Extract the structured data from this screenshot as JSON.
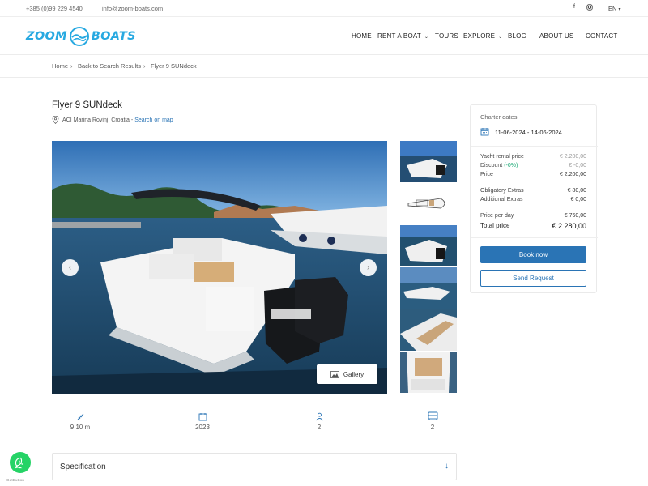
{
  "topbar": {
    "phone": "+385 (0)99 229 4540",
    "email": "info@zoom-boats.com",
    "language": "EN"
  },
  "brand": {
    "word_left": "ZOOM",
    "word_right": "BOATS",
    "color": "#27a9e1"
  },
  "nav": {
    "items": [
      {
        "label": "HOME"
      },
      {
        "label": "RENT A BOAT",
        "dropdown": true
      },
      {
        "label": "TOURS"
      },
      {
        "label": "EXPLORE",
        "dropdown": true
      },
      {
        "label": "BLOG"
      },
      {
        "label": "ABOUT US"
      },
      {
        "label": "CONTACT"
      }
    ]
  },
  "breadcrumb": {
    "home": "Home",
    "back": "Back to Search Results",
    "current": "Flyer 9 SUNdeck"
  },
  "listing": {
    "title": "Flyer 9 SUNdeck",
    "location": "ACI Marina Rovinj, Croatia",
    "map_link": "Search on map",
    "gallery_label": "Gallery"
  },
  "specs": [
    {
      "icon": "length-icon",
      "value": "9.10 m"
    },
    {
      "icon": "calendar-icon",
      "value": "2023"
    },
    {
      "icon": "person-icon",
      "value": "2"
    },
    {
      "icon": "bed-icon",
      "value": "2"
    }
  ],
  "accordion": {
    "label": "Specification"
  },
  "booking": {
    "charter_dates_label": "Charter dates",
    "dates": "11-06-2024 - 14-06-2024",
    "rows": [
      {
        "label": "Yacht rental price",
        "value": "€ 2.200,00"
      },
      {
        "label": "Discount",
        "badge": "(-0%)",
        "value": "€ -0,00"
      },
      {
        "label": "Price",
        "value": "€ 2.200,00"
      },
      {
        "label": "Obligatory Extras",
        "value": "€ 80,00"
      },
      {
        "label": "Additional Extras",
        "value": "€ 0,00"
      },
      {
        "label": "Price per day",
        "value": "€ 760,00"
      },
      {
        "label": "Total price",
        "value": "€ 2.280,00"
      }
    ],
    "book_label": "Book now",
    "request_label": "Send Request"
  },
  "whatsapp_caption": "GetButton",
  "colors": {
    "accent": "#2a74b5",
    "brand": "#27a9e1",
    "whatsapp": "#25d366",
    "discount": "#19a974"
  }
}
